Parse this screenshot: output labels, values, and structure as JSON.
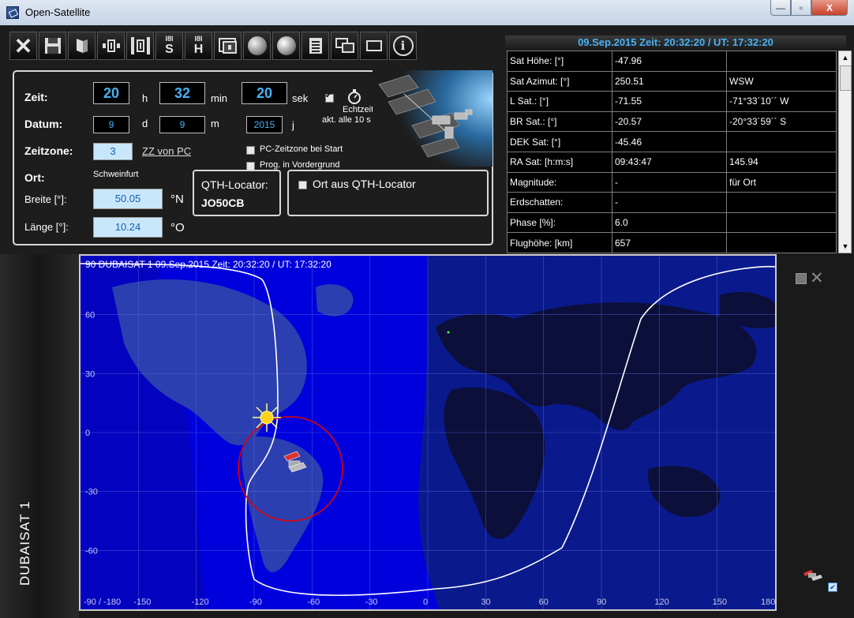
{
  "window": {
    "title": "Open-Satellite",
    "min_label": "—",
    "max_label": "▫",
    "close_label": "X"
  },
  "toolbar": {
    "close_glyph": "✕",
    "btn_s_top": "I8I",
    "btn_s_label": "S",
    "btn_h_top": "I8I",
    "btn_h_label": "H"
  },
  "header": {
    "datetime": "09.Sep.2015   Zeit:  20:32:20  /  UT:  17:32:20"
  },
  "controls": {
    "zeit_label": "Zeit:",
    "hour": "20",
    "h_unit": "h",
    "minute": "32",
    "min_unit": "min",
    "second": "20",
    "sek_unit": "sek",
    "echtzeit_line1": "Echtzeit",
    "echtzeit_line2": "akt. alle 10 s",
    "datum_label": "Datum:",
    "day": "9",
    "d_unit": "d",
    "month": "9",
    "m_unit": "m",
    "year": "2015",
    "j_unit": "j",
    "zeitzone_label": "Zeitzone:",
    "zeitzone_value": "3",
    "zz_link": "ZZ von PC",
    "pc_zeitzone": "PC-Zeitzone bei Start",
    "prog_vordergrund": "Prog. in Vordergrund",
    "ort_label": "Ort:",
    "ort_name": "Schweinfurt",
    "breite_label": "Breite [°]:",
    "breite_value": "50.05",
    "breite_unit": "°N",
    "laenge_label": "Länge [°]:",
    "laenge_value": "10.24",
    "laenge_unit": "°O",
    "qth_label": "QTH-Locator:",
    "qth_value": "JO50CB",
    "ort_aus_qth": "Ort aus QTH-Locator"
  },
  "satinfo": {
    "rows": [
      [
        "Sat Höhe: [°]",
        "-47.96",
        ""
      ],
      [
        "Sat Azimut: [°]",
        "250.51",
        "WSW"
      ],
      [
        "L Sat.: [°]",
        "-71.55",
        "-71°33´10´´ W"
      ],
      [
        "BR Sat.: [°]",
        "-20.57",
        "-20°33´59´´ S"
      ],
      [
        "DEK Sat: [°]",
        "-45.46",
        ""
      ],
      [
        "RA Sat: [h:m:s]",
        "09:43:47",
        "145.94"
      ],
      [
        "Magnitude:",
        "-",
        "für Ort"
      ],
      [
        "Erdschatten:",
        "-",
        ""
      ],
      [
        "Phase [%]:",
        "6.0",
        ""
      ],
      [
        "Flughöhe: [km]",
        "657",
        ""
      ]
    ]
  },
  "map": {
    "title": "90  DUBAISAT 1   09.Sep.2015   Zeit:  20:32:20  /  UT:  17:32:20",
    "sidebar_label": "DUBAISAT 1",
    "lat_labels": [
      "60",
      "30",
      "0",
      "-30",
      "-60"
    ],
    "lon_labels": [
      "-90 / -180",
      "-150",
      "-120",
      "-90",
      "-60",
      "-30",
      "0",
      "30",
      "60",
      "90",
      "120",
      "150",
      "180"
    ],
    "colors": {
      "day": "#0000dd",
      "night": "#0a1a8c",
      "land_day": "#2b3fb0",
      "land_night": "#0b0f3a",
      "track": "#ffffff",
      "footprint": "#e00000",
      "grid": "#5a6ae0"
    }
  }
}
